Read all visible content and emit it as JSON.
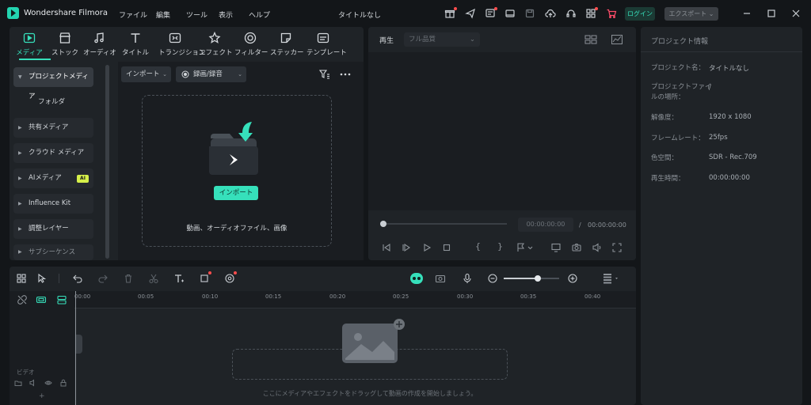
{
  "app": {
    "name": "Wondershare Filmora",
    "document_title": "タイトルなし"
  },
  "menu": [
    "ファイル",
    "編集",
    "ツール",
    "表示",
    "ヘルプ"
  ],
  "titlebar": {
    "login_label": "ログイン",
    "export_label": "エクスポート"
  },
  "media_tabs": [
    {
      "label": "メディア",
      "icon": "media-icon",
      "active": true
    },
    {
      "label": "ストック",
      "icon": "stock-icon"
    },
    {
      "label": "オーディオ",
      "icon": "audio-icon"
    },
    {
      "label": "タイトル",
      "icon": "title-icon"
    },
    {
      "label": "トランジション",
      "icon": "transition-icon"
    },
    {
      "label": "エフェクト",
      "icon": "effect-icon"
    },
    {
      "label": "フィルター",
      "icon": "filter-icon"
    },
    {
      "label": "ステッカー",
      "icon": "sticker-icon"
    },
    {
      "label": "テンプレート",
      "icon": "template-icon"
    }
  ],
  "sidebar": {
    "items": [
      {
        "label": "プロジェクトメディア"
      },
      {
        "label": "フォルダ"
      },
      {
        "label": "共有メディア"
      },
      {
        "label": "クラウド メディア"
      },
      {
        "label": "AIメディア",
        "badge": "AI"
      },
      {
        "label": "Influence Kit"
      },
      {
        "label": "調整レイヤー"
      },
      {
        "label": "サブシーケンス"
      }
    ]
  },
  "media_toolbar": {
    "import_label": "インポート",
    "record_label": "録画/録音"
  },
  "import_area": {
    "button_label": "インポート",
    "hint": "動画、オーディオファイル、画像"
  },
  "preview": {
    "play_label": "再生",
    "quality_label": "フル品質",
    "current_time": "00:00:00:00",
    "separator": "/",
    "total_time": "00:00:00:00"
  },
  "project_info": {
    "title": "プロジェクト情報",
    "rows": [
      {
        "label": "プロジェクト名：",
        "value": "タイトルなし"
      },
      {
        "label": "プロジェクトファイルの場所：",
        "value": "/"
      },
      {
        "label": "解像度：",
        "value": "1920 x 1080"
      },
      {
        "label": "フレームレート：",
        "value": "25fps"
      },
      {
        "label": "色空間：",
        "value": "SDR - Rec.709"
      },
      {
        "label": "再生時間：",
        "value": "00:00:00:00"
      }
    ]
  },
  "timeline": {
    "ruler": [
      "00:00",
      "00:05",
      "00:10",
      "00:15",
      "00:20",
      "00:25",
      "00:30",
      "00:35",
      "00:40"
    ],
    "track_label": "ビデオ",
    "drop_hint": "ここにメディアやエフェクトをドラッグして動画の作成を開始しましょう。"
  },
  "colors": {
    "accent": "#36e0bb",
    "panel": "#1f2327",
    "background": "#131619",
    "notification": "#ff4d4d"
  }
}
